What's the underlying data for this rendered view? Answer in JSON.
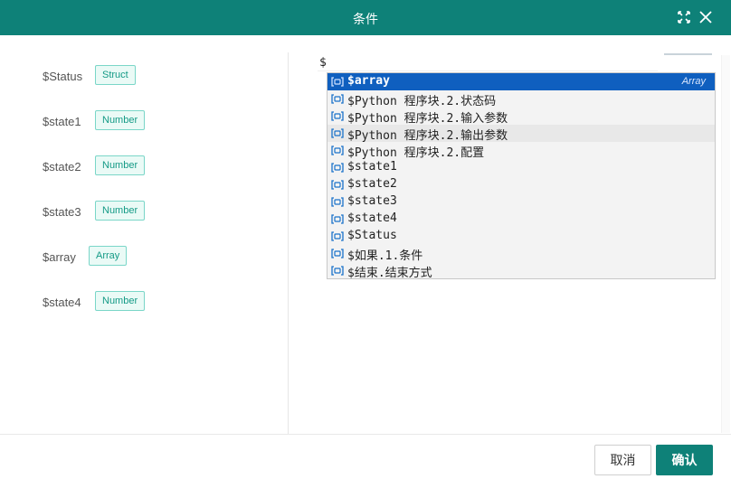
{
  "dialog": {
    "title": "条件",
    "accent_color": "#0e8178"
  },
  "variables": [
    {
      "name": "$Status",
      "type": "Struct"
    },
    {
      "name": "$state1",
      "type": "Number"
    },
    {
      "name": "$state2",
      "type": "Number"
    },
    {
      "name": "$state3",
      "type": "Number"
    },
    {
      "name": "$array",
      "type": "Array"
    },
    {
      "name": "$state4",
      "type": "Number"
    }
  ],
  "editor": {
    "text": "$"
  },
  "suggestions": {
    "selected_color": "#0f5fbf",
    "icon": "variable-icon",
    "items": [
      {
        "label": "$array",
        "type": "Array"
      },
      {
        "label": "$Python 程序块.2.状态码",
        "type": ""
      },
      {
        "label": "$Python 程序块.2.输入参数",
        "type": ""
      },
      {
        "label": "$Python 程序块.2.输出参数",
        "type": ""
      },
      {
        "label": "$Python 程序块.2.配置",
        "type": ""
      },
      {
        "label": "$state1",
        "type": ""
      },
      {
        "label": "$state2",
        "type": ""
      },
      {
        "label": "$state3",
        "type": ""
      },
      {
        "label": "$state4",
        "type": ""
      },
      {
        "label": "$Status",
        "type": ""
      },
      {
        "label": "$如果.1.条件",
        "type": ""
      },
      {
        "label": "$结束.结束方式",
        "type": ""
      }
    ]
  },
  "footer": {
    "cancel_label": "取消",
    "ok_label": "确认"
  }
}
